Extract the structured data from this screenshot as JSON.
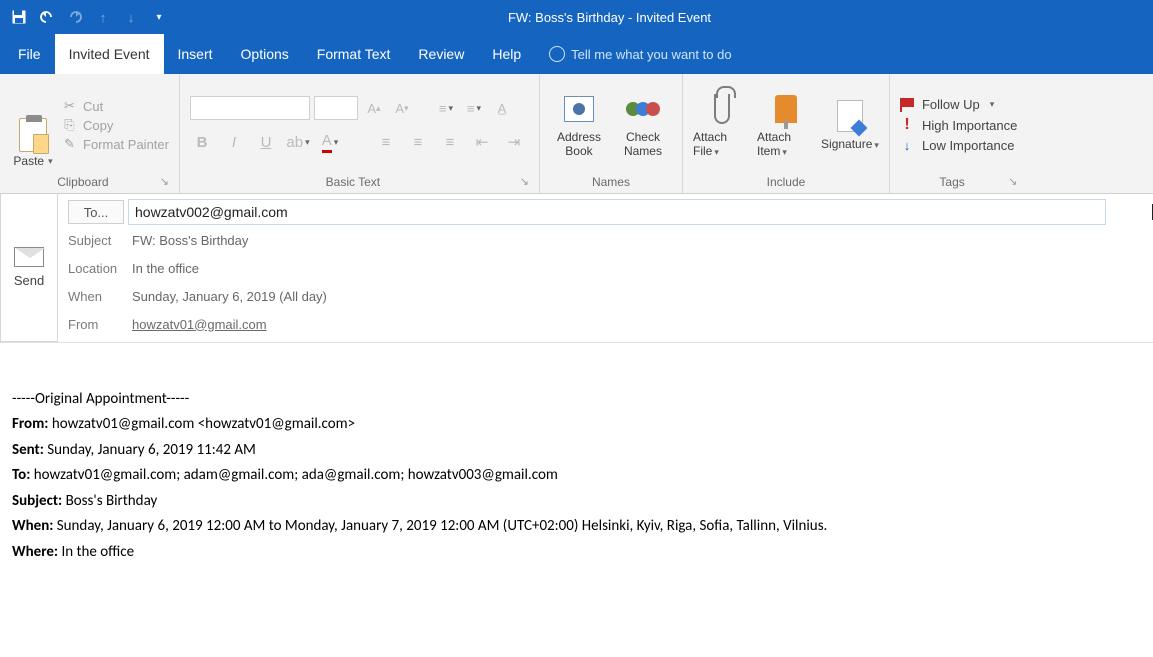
{
  "titlebar": {
    "title": "FW: Boss's Birthday  -  Invited Event"
  },
  "tabs": {
    "file": "File",
    "invited_event": "Invited Event",
    "insert": "Insert",
    "options": "Options",
    "format_text": "Format Text",
    "review": "Review",
    "help": "Help",
    "tellme": "Tell me what you want to do"
  },
  "ribbon": {
    "clipboard": {
      "paste": "Paste",
      "cut": "Cut",
      "copy": "Copy",
      "format_painter": "Format Painter",
      "group": "Clipboard"
    },
    "basic_text": {
      "group": "Basic Text"
    },
    "names": {
      "address_book": "Address Book",
      "check_names": "Check Names",
      "group": "Names"
    },
    "include": {
      "attach_file": "Attach File",
      "attach_item": "Attach Item",
      "signature": "Signature",
      "group": "Include"
    },
    "tags": {
      "follow_up": "Follow Up",
      "high": "High Importance",
      "low": "Low Importance",
      "group": "Tags"
    }
  },
  "compose": {
    "send": "Send",
    "to_label": "To...",
    "to_value": "howzatv002@gmail.com",
    "subject_label": "Subject",
    "subject_value": "FW: Boss's Birthday",
    "location_label": "Location",
    "location_value": "In the office",
    "when_label": "When",
    "when_value": "Sunday, January 6, 2019 (All day)",
    "from_label": "From",
    "from_value": "howzatv01@gmail.com"
  },
  "body": {
    "divider": "-----Original Appointment-----",
    "from_l": "From:",
    "from_v": " howzatv01@gmail.com <howzatv01@gmail.com>",
    "sent_l": "Sent:",
    "sent_v": " Sunday, January 6, 2019 11:42 AM",
    "to_l": "To:",
    "to_v": " howzatv01@gmail.com; adam@gmail.com; ada@gmail.com; howzatv003@gmail.com",
    "subject_l": "Subject:",
    "subject_v": " Boss's Birthday",
    "when_l": "When:",
    "when_v": " Sunday, January 6, 2019 12:00 AM to Monday, January 7, 2019 12:00 AM (UTC+02:00) Helsinki, Kyiv, Riga, Sofia, Tallinn, Vilnius.",
    "where_l": "Where:",
    "where_v": " In the office"
  }
}
